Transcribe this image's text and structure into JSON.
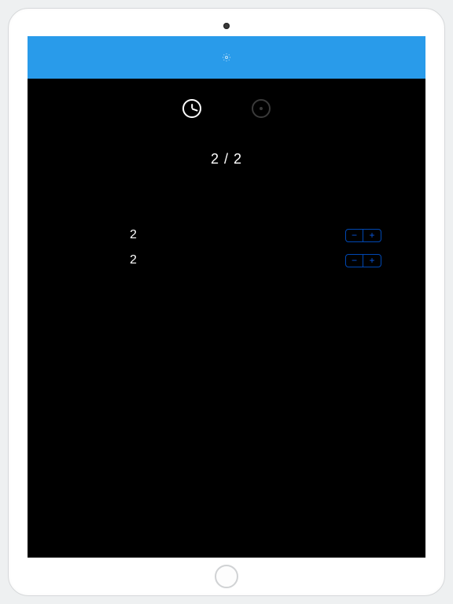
{
  "header": {
    "settings_icon_name": "gear"
  },
  "tabs": {
    "active": "time",
    "inactive": "brightness"
  },
  "ratio": {
    "display": "2 / 2"
  },
  "rows": [
    {
      "value": "2",
      "minus": "−",
      "plus": "+"
    },
    {
      "value": "2",
      "minus": "−",
      "plus": "+"
    }
  ],
  "colors": {
    "header": "#299bea",
    "stepper": "#0a58e0"
  }
}
